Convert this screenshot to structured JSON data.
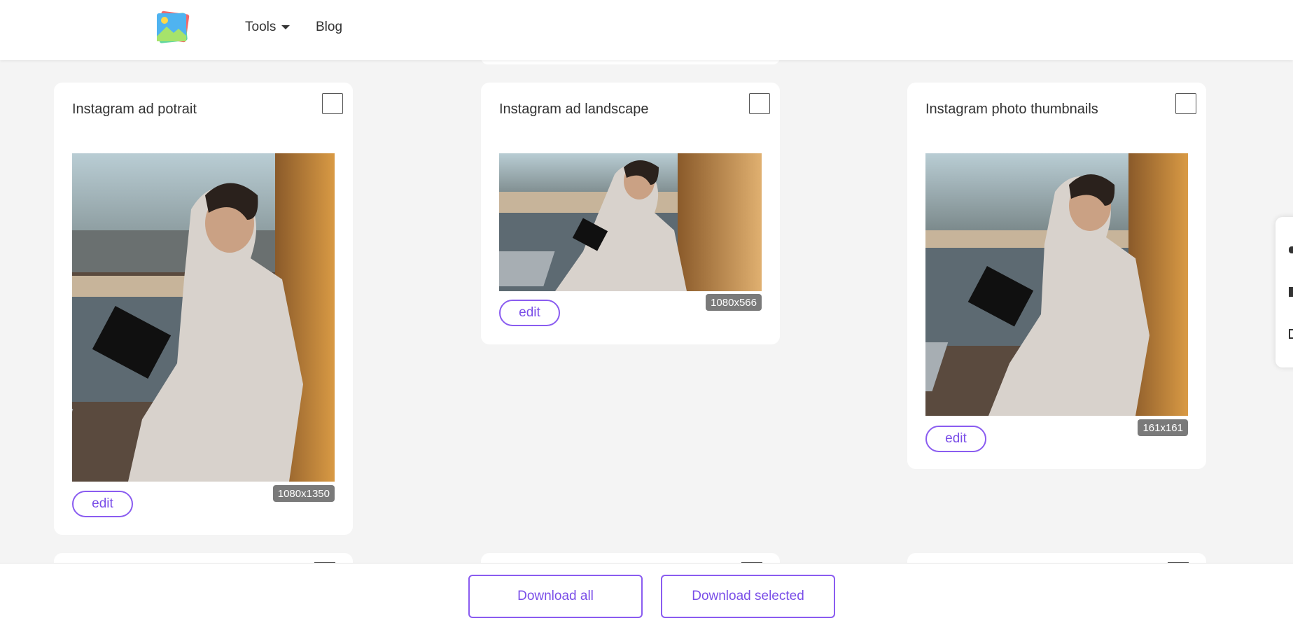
{
  "header": {
    "logo_icon": "photo-stack-logo",
    "nav": {
      "tools_label": "Tools",
      "blog_label": "Blog"
    }
  },
  "cards": [
    {
      "title": "Instagram ad potrait",
      "dimensions": "1080x1350",
      "edit_label": "edit",
      "checked": false
    },
    {
      "title": "Instagram ad landscape",
      "dimensions": "1080x566",
      "edit_label": "edit",
      "checked": false
    },
    {
      "title": "Instagram photo thumbnails",
      "dimensions": "161x161",
      "edit_label": "edit",
      "checked": false
    }
  ],
  "side_widget": {
    "icons": [
      "twitter-icon",
      "facebook-icon",
      "share-icon"
    ]
  },
  "footer": {
    "download_all_label": "Download all",
    "download_selected_label": "Download selected"
  },
  "colors": {
    "accent": "#8a5cf0",
    "badge": "#7a7a7a",
    "background": "#f4f4f4"
  }
}
